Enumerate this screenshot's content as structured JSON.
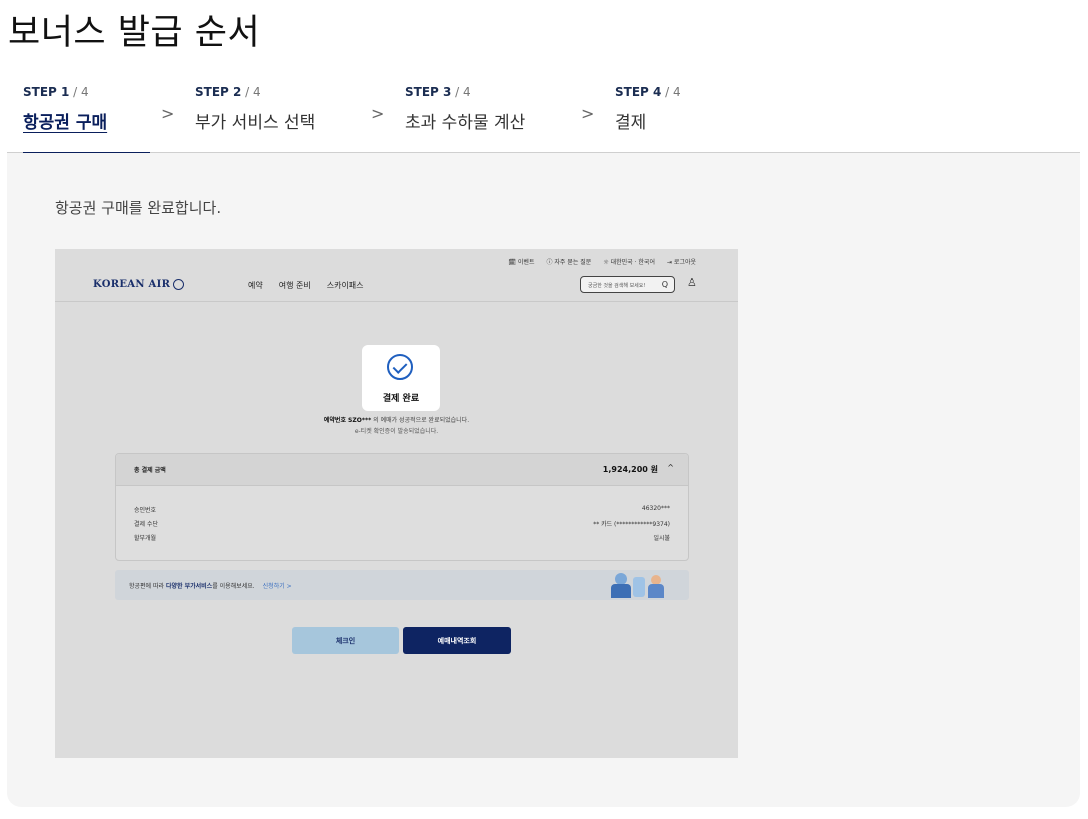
{
  "page_title": "보너스 발급 순서",
  "steps": [
    {
      "num": "STEP 1",
      "of": " / 4",
      "label": "항공권 구매"
    },
    {
      "num": "STEP 2",
      "of": " / 4",
      "label": "부가 서비스 선택"
    },
    {
      "num": "STEP 3",
      "of": " / 4",
      "label": "초과 수하물 계산"
    },
    {
      "num": "STEP 4",
      "of": " / 4",
      "label": "결제"
    }
  ],
  "chevron": ">",
  "description": "항공권 구매를 완료합니다.",
  "screenshot": {
    "util_links": [
      "🗓 이벤트",
      "ⓘ 자주 묻는 질문",
      "☼ 대한민국 · 한국어",
      "⇥ 로그아웃"
    ],
    "logo_text": "KOREAN AIR",
    "nav": [
      "예약",
      "여행 준비",
      "스카이패스"
    ],
    "search_placeholder": "궁금한 것을 검색해 보세요!",
    "search_icon": "Q",
    "user_icon": "♙",
    "done_title": "결제 완료",
    "done_msg_prefix": "예약번호 SZO***",
    "done_msg_suffix": " 의 예매가 성공적으로 완료되었습니다.",
    "done_msg2": "e-티켓 확인증이 발송되었습니다.",
    "payment": {
      "label": "총 결제 금액",
      "amount": "1,924,200 원",
      "caret": "^",
      "rows": [
        {
          "label": "승인번호",
          "value": "46320***"
        },
        {
          "label": "결제 수단",
          "value": "** 카드 (************9374)"
        },
        {
          "label": "할부개월",
          "value": "일시불"
        }
      ]
    },
    "banner": {
      "pre": "항공편에 따라 ",
      "bold": "다양한 부가서비스",
      "post": "를 이용해보세요.",
      "link": "신청하기 >"
    },
    "buttons": {
      "checkin": "체크인",
      "reservation": "예매내역조회"
    }
  },
  "colors": {
    "primary": "#0a1f5c",
    "accent_blue": "#1f5fbf",
    "panel_bg": "#f5f5f5"
  }
}
